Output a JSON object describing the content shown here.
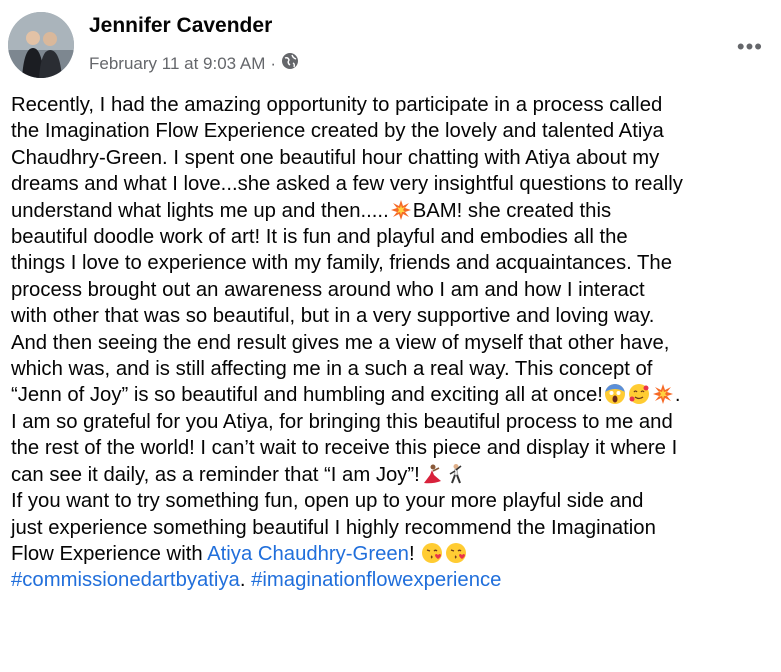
{
  "post": {
    "author": "Jennifer Cavender",
    "timestamp": "February 11 at 9:03 AM",
    "separator": "·",
    "privacy_icon": "globe-icon",
    "more_icon": "more-options-icon",
    "more_label": "•••"
  },
  "body": {
    "l1": "Recently, I had the amazing opportunity to participate in a process called",
    "l2": "the Imagination Flow Experience created by the lovely and talented Atiya",
    "l3": "Chaudhry-Green. I spent one beautiful hour chatting with Atiya about my",
    "l4": "dreams and what I love...she asked a few very insightful questions to really",
    "l5a": "understand what lights me up and then.....",
    "l5b": "BAM! she created this",
    "l6": "beautiful doodle work of art!  It is fun and playful and embodies all the",
    "l7": "things I love to experience with my family, friends and acquaintances. The",
    "l8": "process brought out an awareness around who I am and how I interact",
    "l9": "with other that was so beautiful, but in a very supportive and loving way.",
    "l10": "And then seeing the end result gives me a view of myself that other have,",
    "l11": "which was, and is still affecting me in a such a real way. This concept of",
    "l12a": "“Jenn of Joy” is so beautiful and humbling and exciting all at once!",
    "l12b": ".",
    "l13": "I am so grateful for you Atiya, for bringing this beautiful process to me and",
    "l14": "the rest of the world!  I can’t wait to receive this piece and display it where I",
    "l15": "can see it daily, as a reminder that “I am Joy”!",
    "l16": "If you want to try something fun, open up to your more playful side and",
    "l17": "just experience something beautiful I highly recommend the Imagination",
    "l18a": "Flow Experience with ",
    "mention": "Atiya Chaudhry-Green",
    "l18b": "! ",
    "hashtag1": "#commissionedartbyatiya",
    "l19mid": ". ",
    "hashtag2": "#imaginationflowexperience"
  },
  "emoji_icons": [
    "collision-emoji",
    "scream-emoji",
    "smiling-hearts-emoji",
    "dancer-emoji",
    "man-dancing-emoji",
    "kissing-heart-emoji"
  ]
}
